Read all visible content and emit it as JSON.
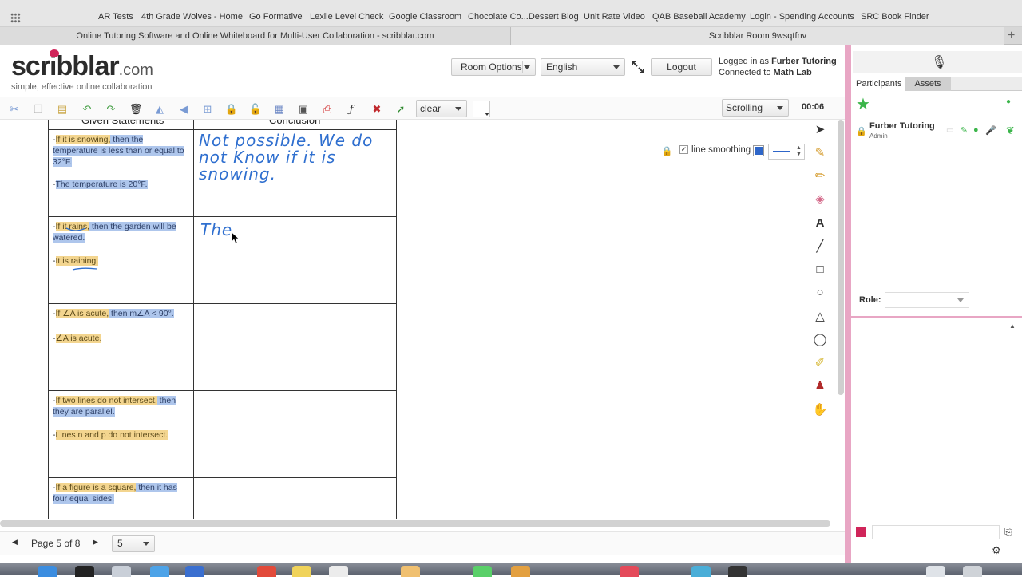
{
  "bookmarks": [
    "AR Tests",
    "4th Grade Wolves - Home",
    "Go Formative",
    "Lexile Level Check",
    "Google Classroom",
    "Chocolate Co...Dessert Blog",
    "Unit Rate Video",
    "QAB Baseball Academy",
    "Login - Spending Accounts",
    "SRC Book Finder"
  ],
  "tabs": [
    "Online Tutoring Software and Online Whiteboard for Multi-User Collaboration - scribblar.com",
    "Scribblar Room 9wsqtfnv"
  ],
  "header": {
    "logo_brand": "scribblar",
    "logo_tld": ".com",
    "logo_tagline": "simple, effective online collaboration",
    "room_options": "Room Options",
    "language": "English",
    "logout": "Logout",
    "logged_in_label": "Logged in as",
    "logged_in_user": "Furber Tutoring",
    "connected_label": "Connected to",
    "connected_room": "Math Lab"
  },
  "toolbar": {
    "clear_label": "clear",
    "scroll_mode": "Scrolling",
    "timer": "00:06"
  },
  "options": {
    "line_smoothing": "line smoothing"
  },
  "worksheet": {
    "col_given": "Given Statements",
    "col_conclusion": "Conclusion",
    "rows": [
      {
        "given_1": [
          {
            "t": "-",
            "c": ""
          },
          {
            "t": "If it is snowing,",
            "c": "y"
          },
          {
            "t": " then the temperature is less than or equal to 32°F.",
            "c": "b"
          }
        ],
        "given_2": [
          {
            "t": "-",
            "c": ""
          },
          {
            "t": "The temperature is 20°F.",
            "c": "b"
          }
        ],
        "conclusion": "Not possible. We do not Know if it is snowing."
      },
      {
        "given_1": [
          {
            "t": "-",
            "c": ""
          },
          {
            "t": "If it rains,",
            "c": "y"
          },
          {
            "t": " then the garden will be watered.",
            "c": "b"
          }
        ],
        "given_2": [
          {
            "t": "-",
            "c": ""
          },
          {
            "t": "It is raining.",
            "c": "y"
          }
        ],
        "conclusion": "The"
      },
      {
        "given_1": [
          {
            "t": "-",
            "c": ""
          },
          {
            "t": "If ∠A is acute,",
            "c": "y"
          },
          {
            "t": " then m∠A < 90°.",
            "c": "b"
          }
        ],
        "given_2": [
          {
            "t": "-",
            "c": ""
          },
          {
            "t": "∠A is acute.",
            "c": "y"
          }
        ],
        "conclusion": ""
      },
      {
        "given_1": [
          {
            "t": "-",
            "c": ""
          },
          {
            "t": "If two lines do not intersect,",
            "c": "y"
          },
          {
            "t": " then they are parallel.",
            "c": "b"
          }
        ],
        "given_2": [
          {
            "t": "-",
            "c": ""
          },
          {
            "t": "Lines n and p do not intersect.",
            "c": "y"
          }
        ],
        "conclusion": ""
      },
      {
        "given_1": [
          {
            "t": "-",
            "c": ""
          },
          {
            "t": "If a figure is a square,",
            "c": "y"
          },
          {
            "t": " then it has four equal sides.",
            "c": "b"
          }
        ],
        "given_2": [],
        "conclusion": ""
      }
    ]
  },
  "pagebar": {
    "page_label": "Page 5 of 8",
    "page_select": "5"
  },
  "panel": {
    "tab_participants": "Participants",
    "tab_assets": "Assets",
    "user_name": "Furber Tutoring",
    "user_role": "Admin",
    "role_label": "Role:"
  },
  "colors": {
    "highlight_yellow": "#f3d58f",
    "highlight_blue": "#aec6ec",
    "ink_blue": "#2f6fcf",
    "panel_pink": "#e8a6c4",
    "brand_pink": "#d0255a"
  }
}
